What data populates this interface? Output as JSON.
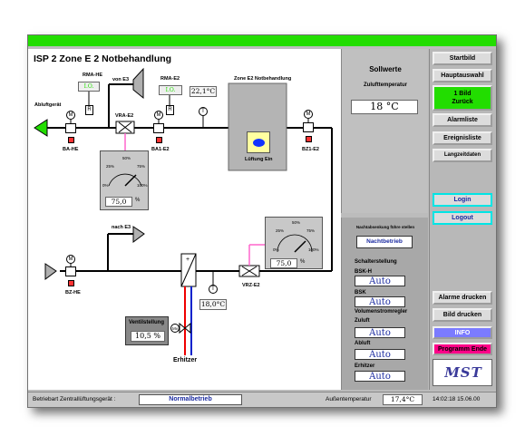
{
  "page": {
    "title": "ISP 2 Zone E 2  Notbehandlung"
  },
  "diagram": {
    "abluftgeraet": "Abluftgerät",
    "rma_he": "RMA-HE",
    "rma_he_value": "I.O.",
    "von_e3": "von E3",
    "rma_e2": "RMA-E2",
    "rma_e2_value": "I.O.",
    "temp_top": "22,1°C",
    "zone_label": "Zone E2 Notbehandlung",
    "lueftung_ein": "Lüftung Ein",
    "vra_e2": "VRA-E2",
    "ba_he": "BA-HE",
    "ba1_e2": "BA1-E2",
    "bz1_e2": "BZ1-E2",
    "nach_e3": "nach E3",
    "bz_he": "BZ-HE",
    "vrz_e2": "VRZ-E2",
    "temp_bottom": "18,0°C",
    "erhitzer": "Erhitzer",
    "ventilstellung_label": "Ventilstellung",
    "ventilstellung_value": "10,5 %",
    "m_label": "M",
    "r_label": "R",
    "t_label": "T",
    "heater_plus": "+",
    "mv_label": "Mv"
  },
  "gauge1": {
    "value": "75,0",
    "unit": "%",
    "ticks": {
      "t0": "0%",
      "t25": "25%",
      "t50": "50%",
      "t75": "75%",
      "t100": "100%"
    },
    "level": 75
  },
  "gauge2": {
    "value": "75,0",
    "unit": "%",
    "ticks": {
      "t0": "0%",
      "t25": "25%",
      "t50": "50%",
      "t75": "75%",
      "t100": "100%"
    },
    "level": 75
  },
  "setpoint": {
    "title": "Sollwerte",
    "subtitle": "Zulufttemperatur",
    "value": "18 °C"
  },
  "nacht": {
    "title": "Nachtabsenkung führe stellen",
    "button": "Nachtbetrieb"
  },
  "schalter": {
    "title": "Schalterstellung",
    "bsk_h_label": "BSK-H",
    "bsk_h_value": "Auto",
    "bsk_label": "BSK",
    "bsk_value": "Auto",
    "volumen_title": "Volumenstromregler",
    "zuluft_label": "Zuluft",
    "zuluft_value": "Auto",
    "abluft_label": "Abluft",
    "abluft_value": "Auto",
    "erhitzer_label": "Erhitzer",
    "erhitzer_value": "Auto"
  },
  "nav": {
    "startbild": "Startbild",
    "hauptauswahl": "Hauptauswahl",
    "zurueck_line1": "1 Bild",
    "zurueck_line2": "Zurück",
    "alarmliste": "Alarmliste",
    "ereignisliste": "Ereignisliste",
    "langzeitdaten": "Langzeitdaten",
    "login": "Login",
    "logout": "Logout",
    "alarme_drucken": "Alarme drucken",
    "bild_drucken": "Bild drucken",
    "info": "INFO",
    "programm_ende": "Programm Ende",
    "logo": "MST"
  },
  "status": {
    "betriebsart_label": "Betriebart Zentrallüftungsgerät :",
    "betriebsart_value": "Normalbetrieb",
    "aussen_label": "Außentemperatur",
    "aussen_value": "17,4°C",
    "datetime": "14:02:18  15.06.00"
  },
  "colors": {
    "green": "#22dd00",
    "accent_cyan": "#00e5e5",
    "pink": "#ff66cc",
    "blue": "#0022cc",
    "red": "#ee0000",
    "info_purple": "#7b7bff",
    "programm_pink": "#ff0088"
  }
}
